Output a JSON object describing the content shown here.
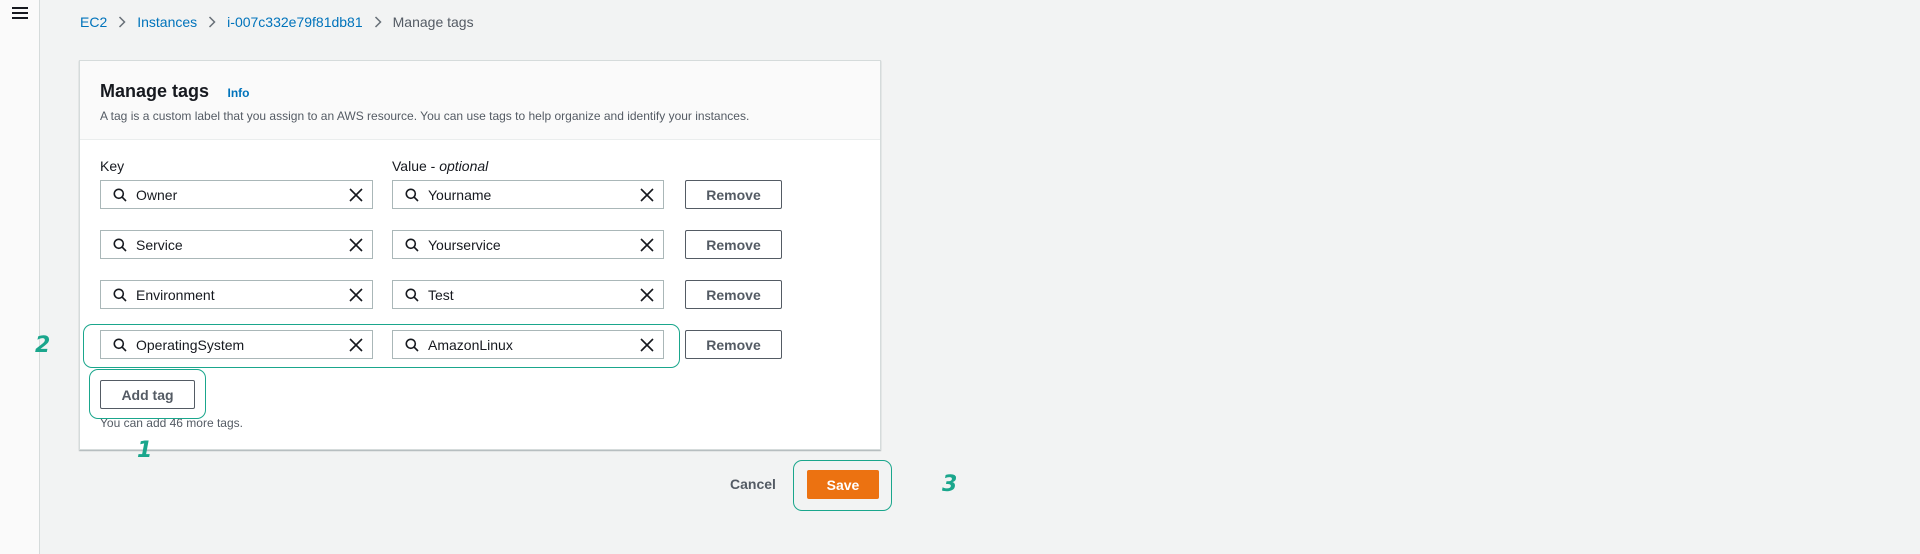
{
  "breadcrumb": {
    "items": [
      "EC2",
      "Instances",
      "i-007c332e79f81db81"
    ],
    "current": "Manage tags"
  },
  "panel": {
    "title": "Manage tags",
    "info_label": "Info",
    "description": "A tag is a custom label that you assign to an AWS resource. You can use tags to help organize and identify your instances."
  },
  "columns": {
    "key_label": "Key",
    "value_label": "Value - ",
    "value_optional": "optional"
  },
  "tags": [
    {
      "key": "Owner",
      "value": "Yourname",
      "remove_label": "Remove"
    },
    {
      "key": "Service",
      "value": "Yourservice",
      "remove_label": "Remove"
    },
    {
      "key": "Environment",
      "value": "Test",
      "remove_label": "Remove"
    },
    {
      "key": "OperatingSystem",
      "value": "AmazonLinux",
      "remove_label": "Remove"
    }
  ],
  "add_tag_label": "Add tag",
  "hint": "You can add 46 more tags.",
  "footer": {
    "cancel_label": "Cancel",
    "save_label": "Save"
  },
  "callouts": [
    "1",
    "2",
    "3"
  ],
  "colors": {
    "accent_orange": "#ec7211",
    "link_blue": "#0073bb",
    "callout_teal": "#1aa68c",
    "background": "#f2f3f3"
  },
  "icons": [
    "menu-icon",
    "chevron-right-icon",
    "search-icon",
    "clear-icon"
  ]
}
